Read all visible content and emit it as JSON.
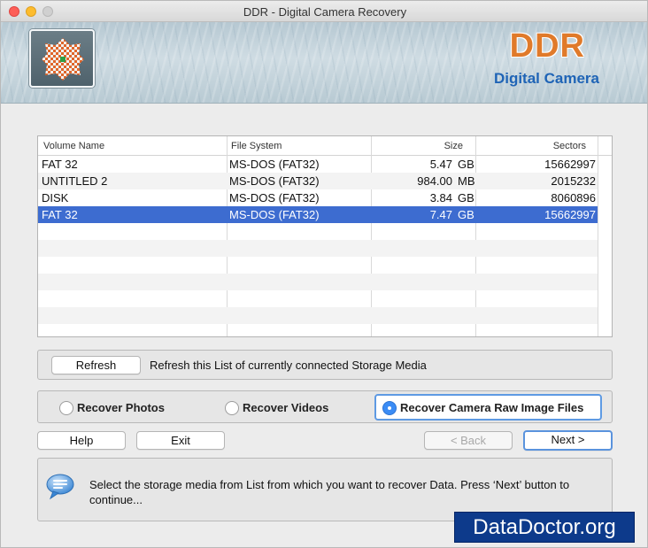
{
  "window": {
    "title": "DDR - Digital Camera Recovery"
  },
  "banner": {
    "brand": "DDR",
    "subtitle": "Digital Camera"
  },
  "table": {
    "columns": [
      "Volume Name",
      "File System",
      "Size",
      "Sectors"
    ],
    "rows": [
      {
        "name": "FAT 32",
        "fs": "MS-DOS (FAT32)",
        "size": "5.47",
        "unit": "GB",
        "sectors": "15662997"
      },
      {
        "name": "UNTITLED 2",
        "fs": "MS-DOS (FAT32)",
        "size": "984.00",
        "unit": "MB",
        "sectors": "2015232"
      },
      {
        "name": "DISK",
        "fs": "MS-DOS (FAT32)",
        "size": "3.84",
        "unit": "GB",
        "sectors": "8060896"
      },
      {
        "name": "FAT 32",
        "fs": "MS-DOS (FAT32)",
        "size": "7.47",
        "unit": "GB",
        "sectors": "15662997"
      }
    ],
    "selected_row": 3
  },
  "refresh": {
    "button_label": "Refresh",
    "description": "Refresh this List of currently connected Storage Media"
  },
  "options": [
    {
      "label": "Recover Photos",
      "checked": false
    },
    {
      "label": "Recover Videos",
      "checked": false
    },
    {
      "label": "Recover Camera Raw Image Files",
      "checked": true
    }
  ],
  "buttons": {
    "help": "Help",
    "exit": "Exit",
    "back": "< Back",
    "next": "Next >"
  },
  "info": {
    "message": "Select the storage media from List from which you want to recover Data. Press ‘Next’ button to continue..."
  },
  "watermark": "DataDoctor.org",
  "colors": {
    "selection": "#3d6cd0",
    "brand_orange": "#e07a2a",
    "brand_blue": "#1f64b6",
    "watermark_bg": "#0d3a8b"
  }
}
